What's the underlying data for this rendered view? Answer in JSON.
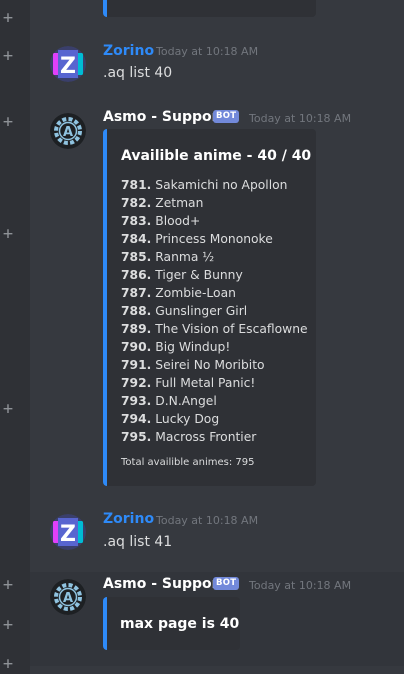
{
  "messages": {
    "m1": {
      "author": "Zorino",
      "timestamp": "Today at 10:18 AM",
      "text": ".aq list 40"
    },
    "m2": {
      "author": "Asmo - Support",
      "badge": "BOT",
      "timestamp": "Today at 10:18 AM",
      "embed": {
        "title": "Availible anime - 40 / 40",
        "items": [
          {
            "num": "781.",
            "title": "Sakamichi no Apollon"
          },
          {
            "num": "782.",
            "title": "Zetman"
          },
          {
            "num": "783.",
            "title": "Blood+"
          },
          {
            "num": "784.",
            "title": "Princess Mononoke"
          },
          {
            "num": "785.",
            "title": "Ranma ½"
          },
          {
            "num": "786.",
            "title": "Tiger & Bunny"
          },
          {
            "num": "787.",
            "title": "Zombie-Loan"
          },
          {
            "num": "788.",
            "title": "Gunslinger Girl"
          },
          {
            "num": "789.",
            "title": "The Vision of Escaflowne"
          },
          {
            "num": "790.",
            "title": "Big Windup!"
          },
          {
            "num": "791.",
            "title": "Seirei No Moribito"
          },
          {
            "num": "792.",
            "title": "Full Metal Panic!"
          },
          {
            "num": "793.",
            "title": "D.N.Angel"
          },
          {
            "num": "794.",
            "title": "Lucky Dog"
          },
          {
            "num": "795.",
            "title": "Macross Frontier"
          }
        ],
        "footer": "Total availible animes: 795"
      }
    },
    "m3": {
      "author": "Zorino",
      "timestamp": "Today at 10:18 AM",
      "text": ".aq list 41"
    },
    "m4": {
      "author": "Asmo - Support",
      "badge": "BOT",
      "timestamp": "Today at 10:18 AM",
      "embed": {
        "title": "max page is 40"
      }
    }
  },
  "colors": {
    "background": "#36393f",
    "gutter": "#2f3136",
    "zorino_name": "#2e8af8",
    "bot_badge": "#7289da",
    "embed_accent": "#2e8af8",
    "timestamp": "#72767d"
  },
  "icons": {
    "add": "plus-icon",
    "zorino_avatar": "z-logo-avatar",
    "asmo_avatar": "gear-a-avatar"
  }
}
